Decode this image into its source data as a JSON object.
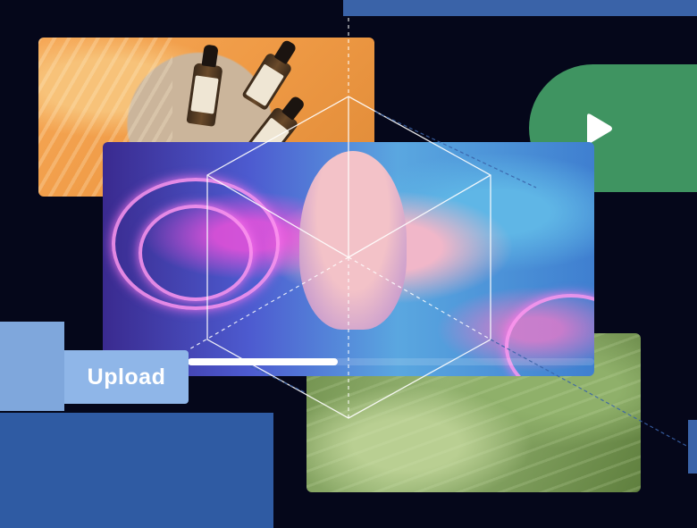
{
  "upload": {
    "label": "Upload"
  },
  "progress": {
    "fraction": 0.37
  },
  "icons": {
    "play": "play-icon"
  },
  "colors": {
    "background": "#05071a",
    "accent_blue": "#2f5ba3",
    "upload_button": "#8fb6e8",
    "play_card_green": "#3f9461"
  }
}
